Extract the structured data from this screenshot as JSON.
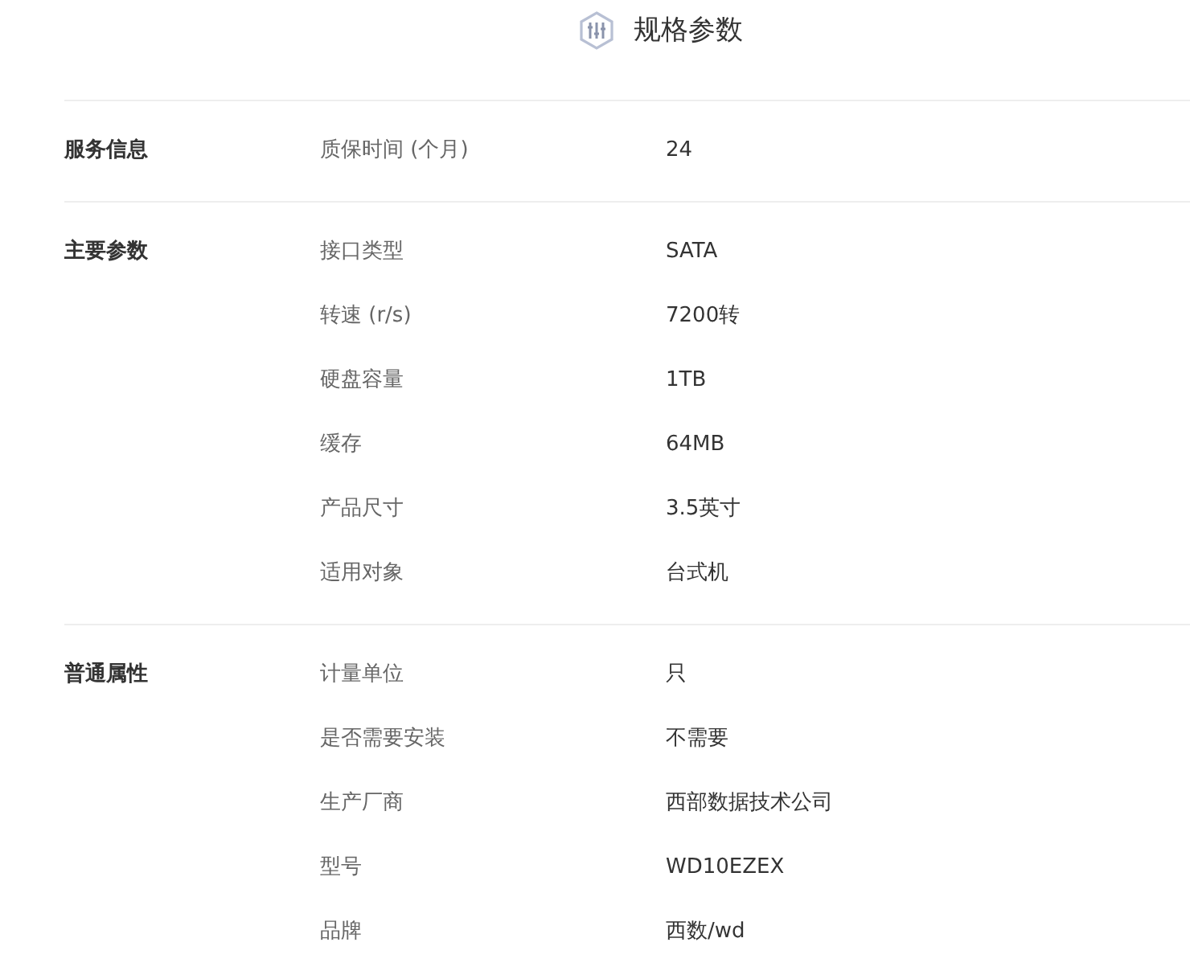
{
  "title": "规格参数",
  "groups": [
    {
      "name": "服务信息",
      "rows": [
        {
          "key": "质保时间 (个月)",
          "value": "24"
        }
      ]
    },
    {
      "name": "主要参数",
      "rows": [
        {
          "key": "接口类型",
          "value": "SATA"
        },
        {
          "key": "转速 (r/s)",
          "value": "7200转"
        },
        {
          "key": "硬盘容量",
          "value": "1TB"
        },
        {
          "key": "缓存",
          "value": "64MB"
        },
        {
          "key": "产品尺寸",
          "value": "3.5英寸"
        },
        {
          "key": "适用对象",
          "value": "台式机"
        }
      ]
    },
    {
      "name": "普通属性",
      "rows": [
        {
          "key": "计量单位",
          "value": "只"
        },
        {
          "key": "是否需要安装",
          "value": "不需要"
        },
        {
          "key": "生产厂商",
          "value": "西部数据技术公司"
        },
        {
          "key": "型号",
          "value": "WD10EZEX"
        },
        {
          "key": "品牌",
          "value": "西数/wd"
        }
      ]
    }
  ]
}
